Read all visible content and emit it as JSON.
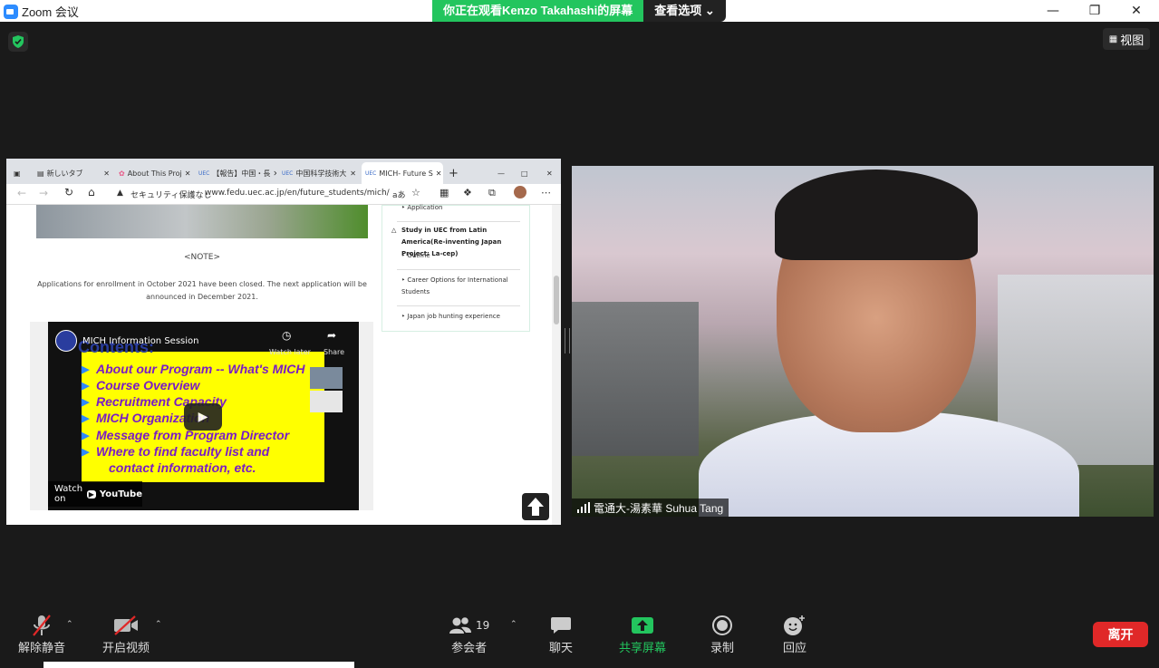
{
  "app": {
    "title": "Zoom 会议"
  },
  "share": {
    "viewing": "你正在观看Kenzo Takahashi的屏幕",
    "options": "查看选项"
  },
  "view_button": {
    "label": "视图"
  },
  "browser": {
    "tabs": [
      {
        "label": "新しいタブ"
      },
      {
        "label": "About This Proj"
      },
      {
        "label": "【報告】中国・長"
      },
      {
        "label": "中国科学技術大"
      },
      {
        "label": "MICH- Future S"
      }
    ],
    "address": {
      "security": "セキュリティ保護なし",
      "url": "www.fedu.uec.ac.jp/en/future_students/mich/",
      "reader": "aあ"
    },
    "page": {
      "note": "<NOTE>",
      "application_text": "Applications for enrollment in October 2021 have been closed. The next application will be announced in December 2021.",
      "video": {
        "title": "MICH Information Session",
        "watch_later": "Watch later",
        "share": "Share",
        "watch_on": "Watch on",
        "youtube": "YouTube",
        "slide_heading": "Contents:",
        "slide_lines": [
          "About our Program -- What's MICH",
          "Course Overview",
          "Recruitment Capacity",
          "MICH Organization",
          "Message  from Program Director",
          "Where to find faculty list and",
          "contact information, etc."
        ]
      },
      "sidebar": [
        "Application",
        "Study in UEC from Latin America(Re-inventing Japan Project: La-cep)",
        "Outline",
        "Career Options for International Students",
        "Japan job hunting experience"
      ]
    }
  },
  "participant": {
    "name": "電通大-湯素華 Suhua Tang"
  },
  "toolbar": {
    "unmute": "解除静音",
    "start_video": "开启视频",
    "participants": "参会者",
    "participants_count": "19",
    "chat": "聊天",
    "share_screen": "共享屏幕",
    "record": "录制",
    "reactions": "回应",
    "leave": "离开"
  },
  "colors": {
    "share_green": "#23c55e",
    "leave_red": "#e02828",
    "bg": "#1a1a1a"
  }
}
